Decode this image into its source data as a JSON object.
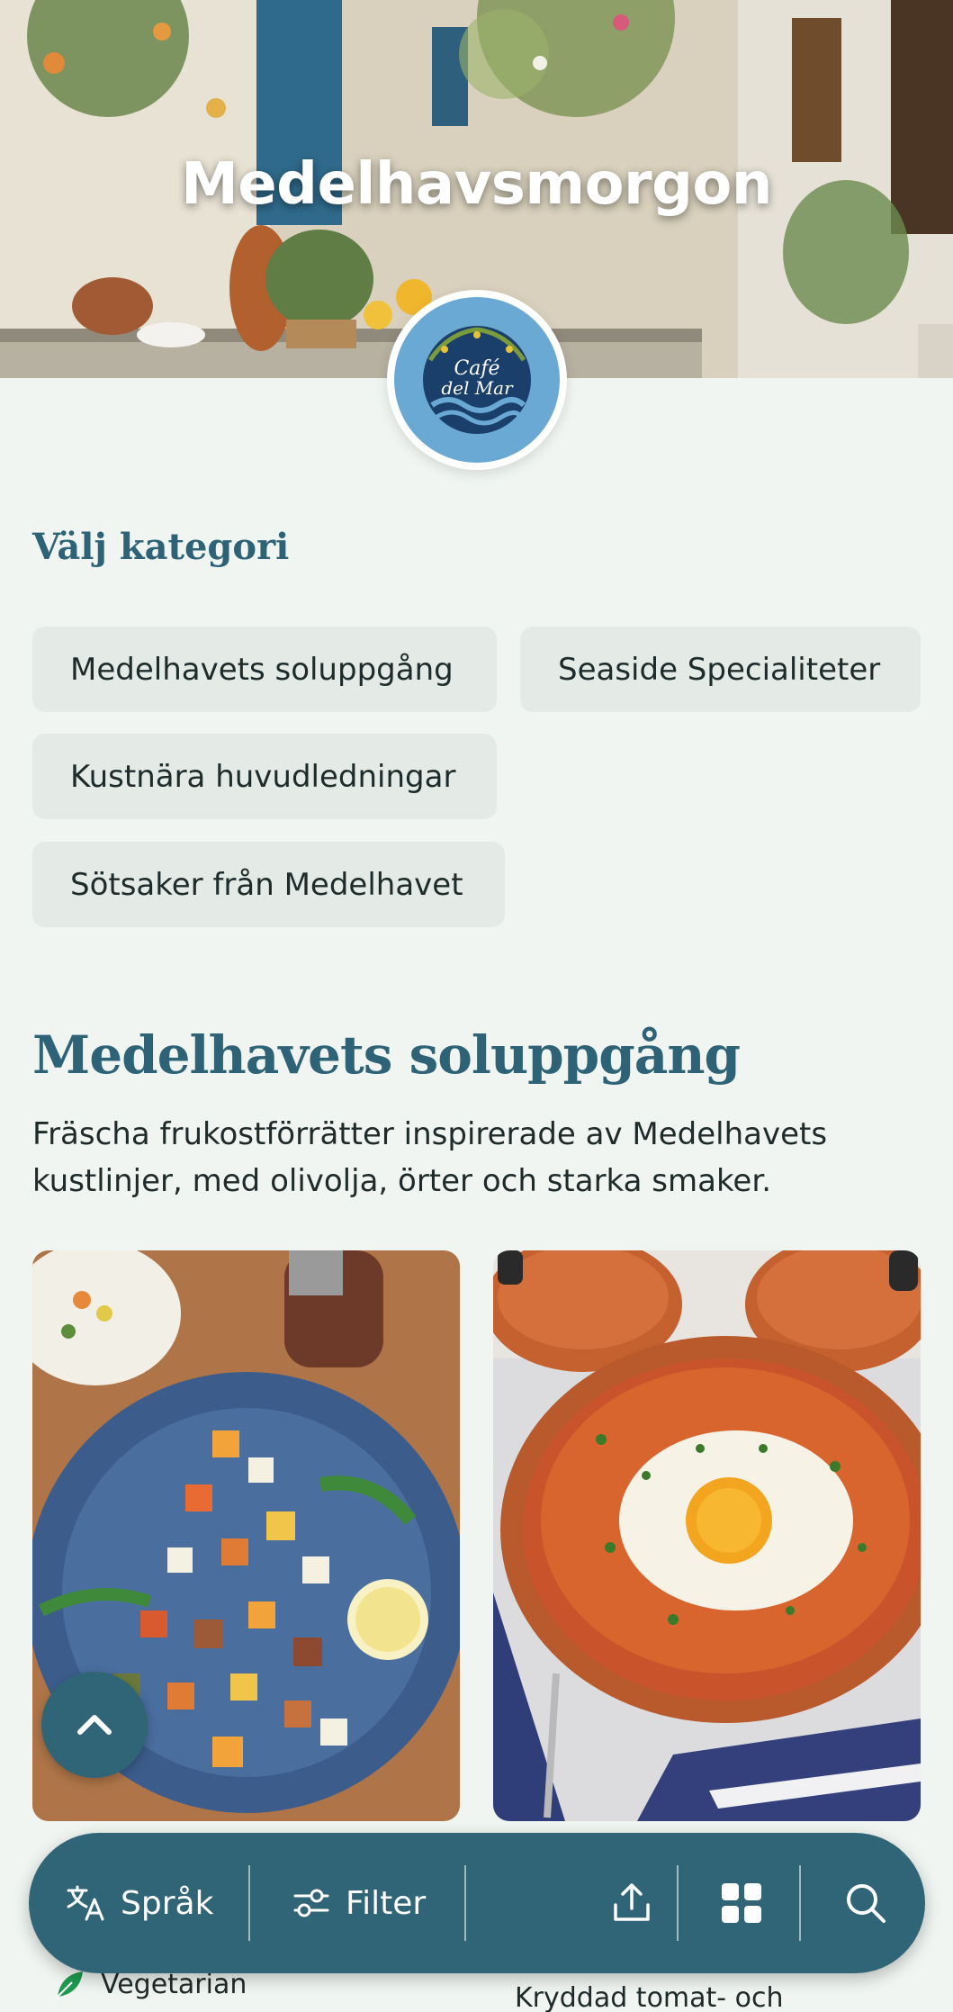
{
  "hero": {
    "title": "Medelhavsmorgon"
  },
  "logo": {
    "line1": "Café",
    "line2": "del Mar"
  },
  "categories": {
    "heading": "Välj kategori",
    "items": [
      {
        "label": "Medelhavets soluppgång"
      },
      {
        "label": "Seaside Specialiteter"
      },
      {
        "label": "Kustnära huvudledningar"
      },
      {
        "label": "Sötsaker från Medelhavet"
      }
    ]
  },
  "section": {
    "title": "Medelhavets soluppgång",
    "description": "Fräscha frukostförrätter inspirerade av Medelhavets kustlinjer, med olivolja, örter och starka smaker."
  },
  "cards": [
    {
      "tag": "Vegetarian",
      "tag_icon": "leaf-icon"
    },
    {
      "name_partial": "Kryddad tomat- och"
    }
  ],
  "bottom_bar": {
    "language_label": "Språk",
    "filter_label": "Filter",
    "icons": [
      "translate-icon",
      "filter-icon",
      "share-icon",
      "grid-icon",
      "search-icon"
    ]
  },
  "colors": {
    "primary": "#2f6576",
    "heading": "#2e6377",
    "background": "#f0f5f1",
    "chip": "#e4ebe7",
    "accent_green": "#1e9a4f"
  }
}
